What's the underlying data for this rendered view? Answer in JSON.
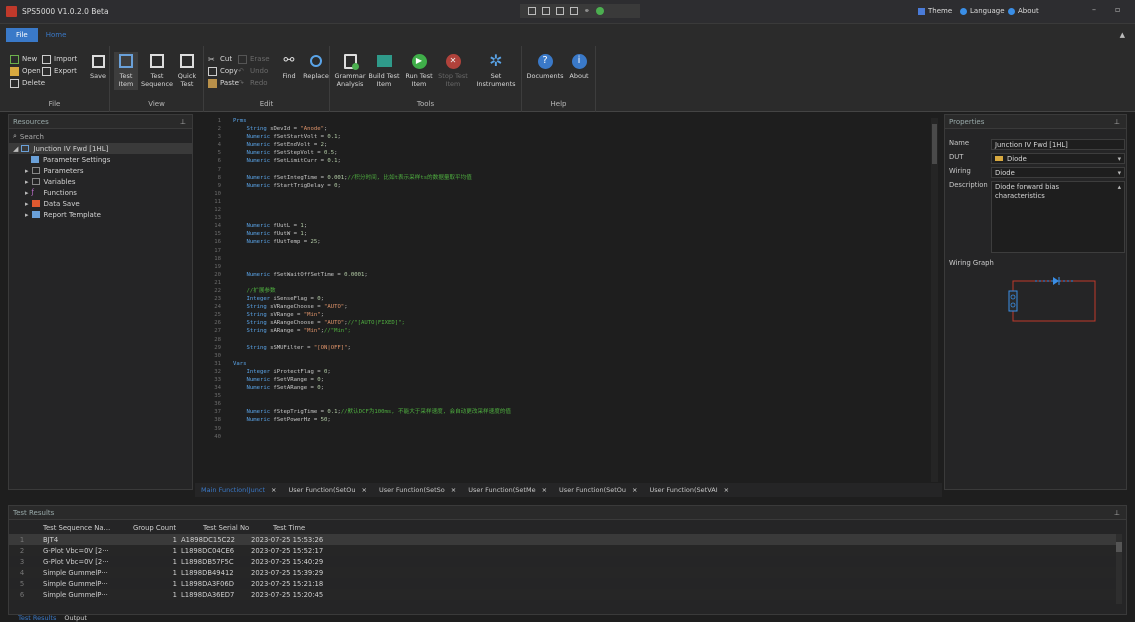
{
  "app": {
    "title": "SPS5000 V1.0.2.0 Beta",
    "theme_label": "Theme",
    "language_label": "Language",
    "about_label": "About"
  },
  "menu": {
    "file": "File",
    "home": "Home"
  },
  "ribbon": {
    "file_group": {
      "label": "File",
      "new": "New",
      "import": "Import",
      "open": "Open",
      "export": "Export",
      "delete": "Delete",
      "save": "Save"
    },
    "view_group": {
      "label": "View",
      "test_item": "Test Item",
      "test_sequence": "Test Sequence",
      "quick_test": "Quick Test"
    },
    "edit_group": {
      "label": "Edit",
      "cut": "Cut",
      "erase": "Erase",
      "copy": "Copy",
      "undo": "Undo",
      "paste": "Paste",
      "redo": "Redo",
      "find": "Find",
      "replace": "Replace"
    },
    "tools_group": {
      "label": "Tools",
      "grammar": "Grammar Analysis",
      "build": "Build Test Item",
      "run": "Run Test Item",
      "stop": "Stop Test Item",
      "set_instruments": "Set Instruments"
    },
    "help_group": {
      "label": "Help",
      "documents": "Documents",
      "about": "About"
    }
  },
  "resources": {
    "header": "Resources",
    "search": "Search",
    "root": "Junction IV Fwd [1HL]",
    "items": [
      "Parameter Settings",
      "Parameters",
      "Variables",
      "Functions",
      "Data Save",
      "Report Template"
    ]
  },
  "editor": {
    "lines": [
      "Prms",
      "    String sDevId = \"Anode\";",
      "    Numeric fSetStartVolt = 0.1;",
      "    Numeric fSetEndVolt = 2;",
      "    Numeric fSetStepVolt = 0.5;",
      "    Numeric fSetLimitCurr = 0.1;",
      "",
      "    Numeric fSetIntegTime = 0.001;//积分时间, 比如t表示采样ts的数据量取平均值",
      "    Numeric fStartTrigDelay = 0;",
      "",
      "",
      "",
      "",
      "    Numeric fUutL = 1;",
      "    Numeric fUutW = 1;",
      "    Numeric fUutTemp = 25;",
      "",
      "",
      "",
      "    Numeric fSetWaitOffSetTime = 0.0001;",
      "",
      "    //扩展参数",
      "    Integer iSenseFlag = 0;",
      "    String sVRangeChoose = \"AUTO\";",
      "    String sVRange = \"Min\";",
      "    String sARangeChoose = \"AUTO\";//\"[AUTO|FIXED]\";",
      "    String sARange = \"Min\";//\"Min\";",
      "",
      "    String sSMUFilter = \"[ON|OFF]\";",
      "",
      "Vars",
      "    Integer iProtectFlag = 0;",
      "    Numeric fSetVRange = 0;",
      "    Numeric fSetARange = 0;",
      "",
      "",
      "    Numeric fStepTrigTime = 0.1;//默认DCF为100ms, 不能大于采样速度, 会自动更改采样速度的值",
      "    Numeric fSetPowerHz = 50;",
      "",
      ""
    ],
    "tabs": [
      "Main Function(Junct",
      "User Function(SetOu",
      "User Function(SetSo",
      "User Function(SetMe",
      "User Function(SetOu",
      "User Function(SetVAI"
    ]
  },
  "properties": {
    "header": "Properties",
    "name_label": "Name",
    "name_value": "Junction IV Fwd [1HL]",
    "dut_label": "DUT",
    "dut_value": "Diode",
    "wiring_label": "Wiring",
    "wiring_value": "Diode",
    "description_label": "Description",
    "description_value": "Diode forward bias characteristics",
    "wiring_graph_label": "Wiring Graph"
  },
  "results": {
    "header": "Test Results",
    "columns": [
      "Test Sequence Na…",
      "Group Count",
      "Test Serial No",
      "Test Time"
    ],
    "rows": [
      {
        "n": "1",
        "seq": "BJT4",
        "count": "1",
        "serial": "A1898DC15C22",
        "time": "2023-07-25 15:53:26"
      },
      {
        "n": "2",
        "seq": "G-Plot Vbc=0V [2···",
        "count": "1",
        "serial": "L1898DC04CE6",
        "time": "2023-07-25 15:52:17"
      },
      {
        "n": "3",
        "seq": "G-Plot Vbc=0V [2···",
        "count": "1",
        "serial": "L1898DB57F5C",
        "time": "2023-07-25 15:40:29"
      },
      {
        "n": "4",
        "seq": "Simple GummelP···",
        "count": "1",
        "serial": "L1898DB49412",
        "time": "2023-07-25 15:39:29"
      },
      {
        "n": "5",
        "seq": "Simple GummelP···",
        "count": "1",
        "serial": "L1898DA3F06D",
        "time": "2023-07-25 15:21:18"
      },
      {
        "n": "6",
        "seq": "Simple GummelP···",
        "count": "1",
        "serial": "L1898DA36ED7",
        "time": "2023-07-25 15:20:45"
      }
    ]
  },
  "bottom_tabs": [
    "Test Results",
    "Output"
  ],
  "colors": {
    "accent": "#3a79c8",
    "keyword": "#5aa4e8",
    "string": "#e0946a",
    "comment": "#4fb040"
  }
}
